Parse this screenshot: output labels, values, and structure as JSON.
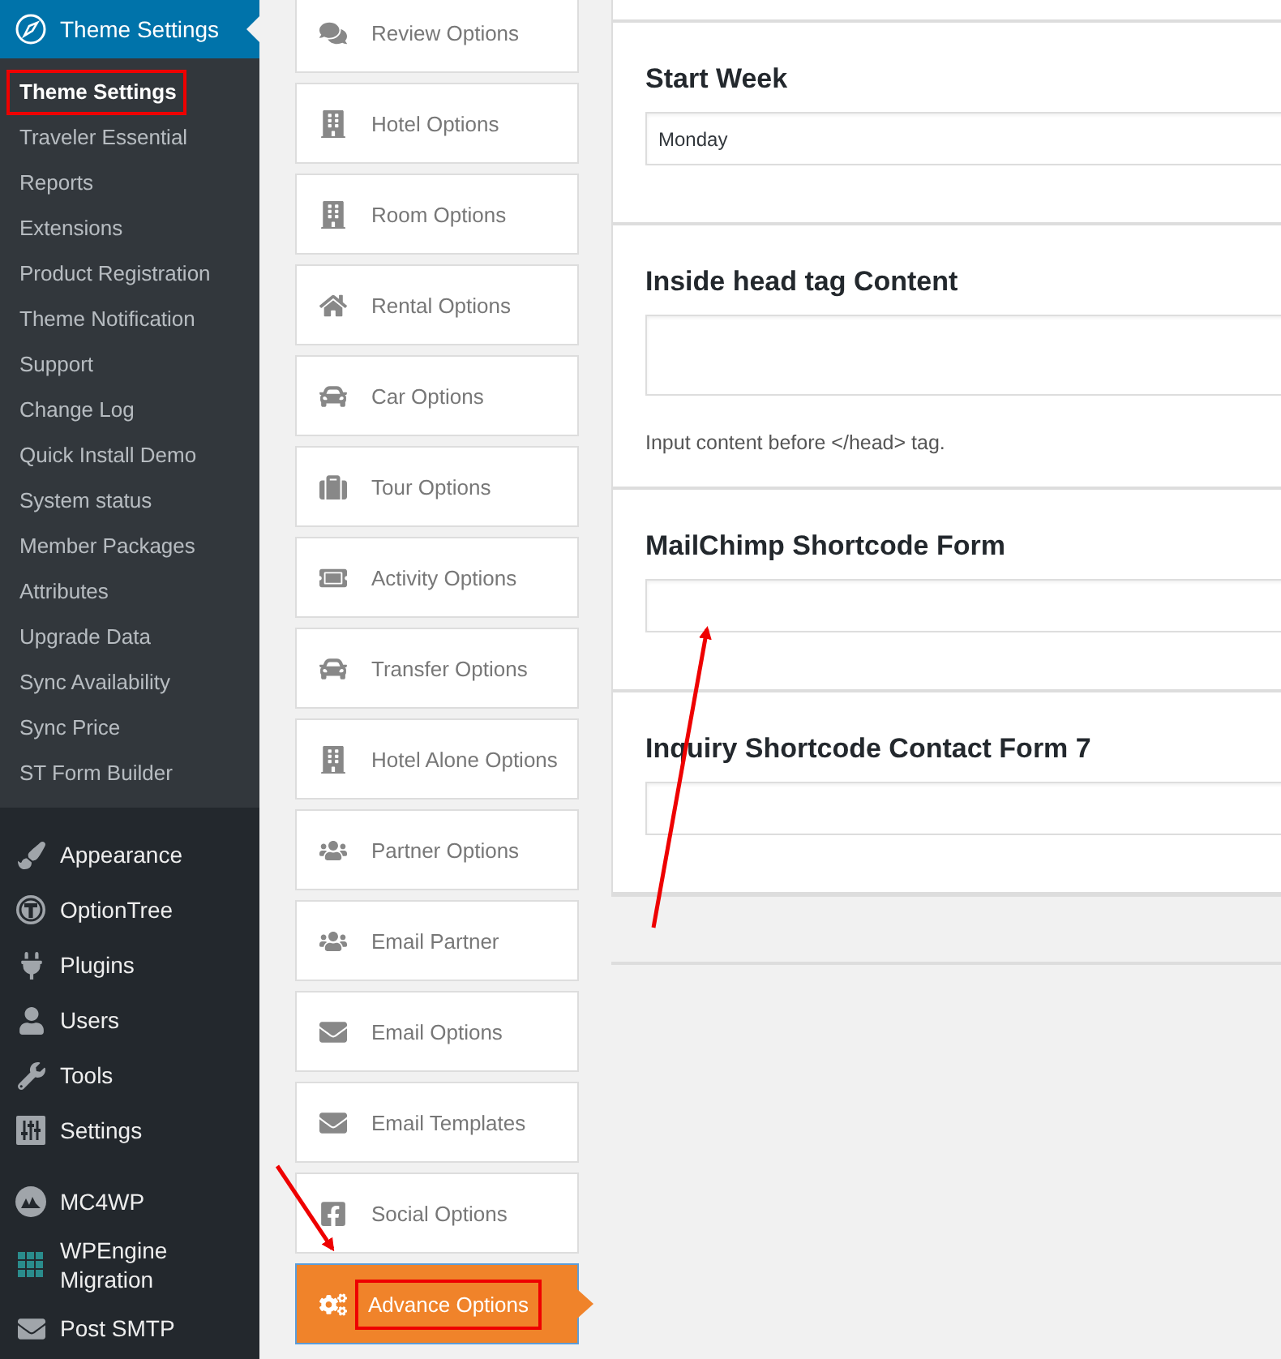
{
  "sidebar": {
    "current": {
      "label": "Theme Settings"
    },
    "submenu": [
      {
        "label": "Theme Settings",
        "selected": true,
        "annotated": true
      },
      {
        "label": "Traveler Essential",
        "selected": false,
        "annotated": false
      },
      {
        "label": "Reports",
        "selected": false,
        "annotated": false
      },
      {
        "label": "Extensions",
        "selected": false,
        "annotated": false
      },
      {
        "label": "Product Registration",
        "selected": false,
        "annotated": false
      },
      {
        "label": "Theme Notification",
        "selected": false,
        "annotated": false
      },
      {
        "label": "Support",
        "selected": false,
        "annotated": false
      },
      {
        "label": "Change Log",
        "selected": false,
        "annotated": false
      },
      {
        "label": "Quick Install Demo",
        "selected": false,
        "annotated": false
      },
      {
        "label": "System status",
        "selected": false,
        "annotated": false
      },
      {
        "label": "Member Packages",
        "selected": false,
        "annotated": false
      },
      {
        "label": "Attributes",
        "selected": false,
        "annotated": false
      },
      {
        "label": "Upgrade Data",
        "selected": false,
        "annotated": false
      },
      {
        "label": "Sync Availability",
        "selected": false,
        "annotated": false
      },
      {
        "label": "Sync Price",
        "selected": false,
        "annotated": false
      },
      {
        "label": "ST Form Builder",
        "selected": false,
        "annotated": false
      }
    ],
    "menu_sections": [
      {
        "items": [
          {
            "label": "Appearance"
          },
          {
            "label": "OptionTree"
          },
          {
            "label": "Plugins"
          },
          {
            "label": "Users"
          },
          {
            "label": "Tools"
          },
          {
            "label": "Settings"
          }
        ]
      },
      {
        "items": [
          {
            "label": "MC4WP"
          },
          {
            "label": "WPEngine Migration"
          },
          {
            "label": "Post SMTP"
          }
        ]
      }
    ]
  },
  "option_tabs": [
    {
      "label": "Review Options",
      "selected": false,
      "annotated": false
    },
    {
      "label": "Hotel Options",
      "selected": false,
      "annotated": false
    },
    {
      "label": "Room Options",
      "selected": false,
      "annotated": false
    },
    {
      "label": "Rental Options",
      "selected": false,
      "annotated": false
    },
    {
      "label": "Car Options",
      "selected": false,
      "annotated": false
    },
    {
      "label": "Tour Options",
      "selected": false,
      "annotated": false
    },
    {
      "label": "Activity Options",
      "selected": false,
      "annotated": false
    },
    {
      "label": "Transfer Options",
      "selected": false,
      "annotated": false
    },
    {
      "label": "Hotel Alone Options",
      "selected": false,
      "annotated": false
    },
    {
      "label": "Partner Options",
      "selected": false,
      "annotated": false
    },
    {
      "label": "Email Partner",
      "selected": false,
      "annotated": false
    },
    {
      "label": "Email Options",
      "selected": false,
      "annotated": false
    },
    {
      "label": "Email Templates",
      "selected": false,
      "annotated": false
    },
    {
      "label": "Social Options",
      "selected": false,
      "annotated": false
    },
    {
      "label": "Advance Options",
      "selected": true,
      "annotated": true
    }
  ],
  "fields": [
    {
      "label": "Start Week",
      "kind": "select",
      "value": "Monday"
    },
    {
      "label": "Inside head tag Content",
      "kind": "textarea",
      "help": "Input content before </head> tag."
    },
    {
      "label": "MailChimp Shortcode Form",
      "kind": "text"
    },
    {
      "label": "Inquiry Shortcode Contact Form 7",
      "kind": "text"
    }
  ]
}
